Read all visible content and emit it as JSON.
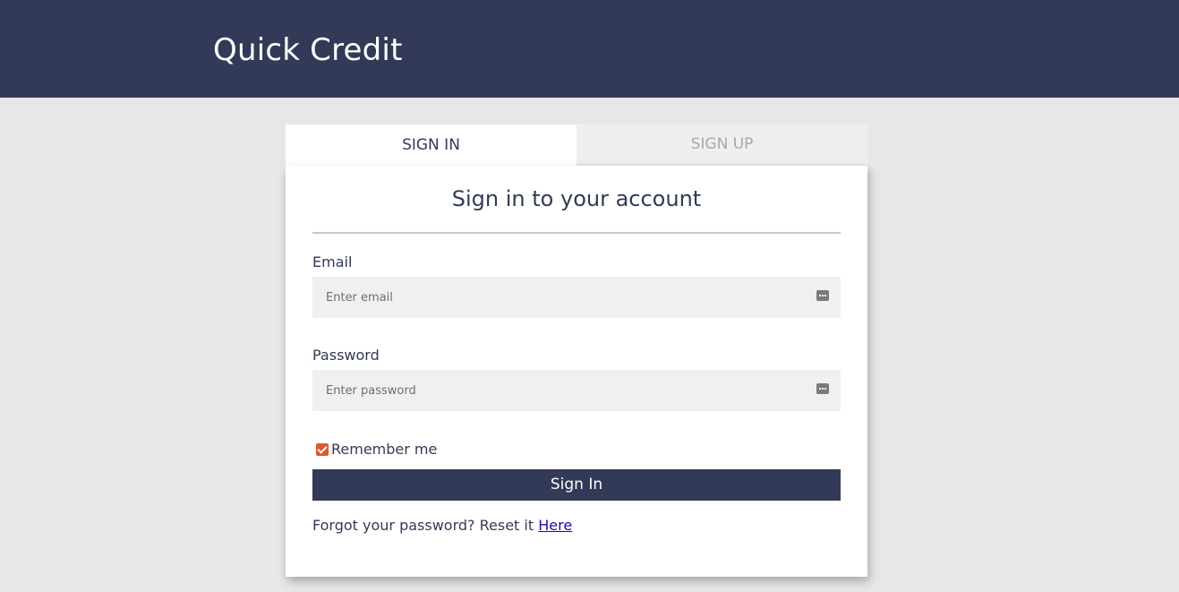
{
  "header": {
    "brand": "Quick Credit"
  },
  "tabs": {
    "signin": "SIGN IN",
    "signup": "SIGN UP"
  },
  "form": {
    "title": "Sign in to your account",
    "email_label": "Email",
    "email_placeholder": "Enter email",
    "email_value": "",
    "password_label": "Password",
    "password_placeholder": "Enter password",
    "password_value": "",
    "remember_label": "Remember me",
    "remember_checked": true,
    "submit_label": "Sign In",
    "forgot_text": "Forgot your password? Reset it",
    "forgot_link": "Here"
  },
  "icons": {
    "email_field_icon": "password-manager-icon",
    "password_field_icon": "password-manager-icon",
    "checkbox_icon": "checkmark-icon"
  },
  "colors": {
    "header_bg": "#333a57",
    "page_bg": "#e7e7e7",
    "accent_checkbox": "#e0582a",
    "button_bg": "#333a57",
    "link": "#1a0dab"
  }
}
